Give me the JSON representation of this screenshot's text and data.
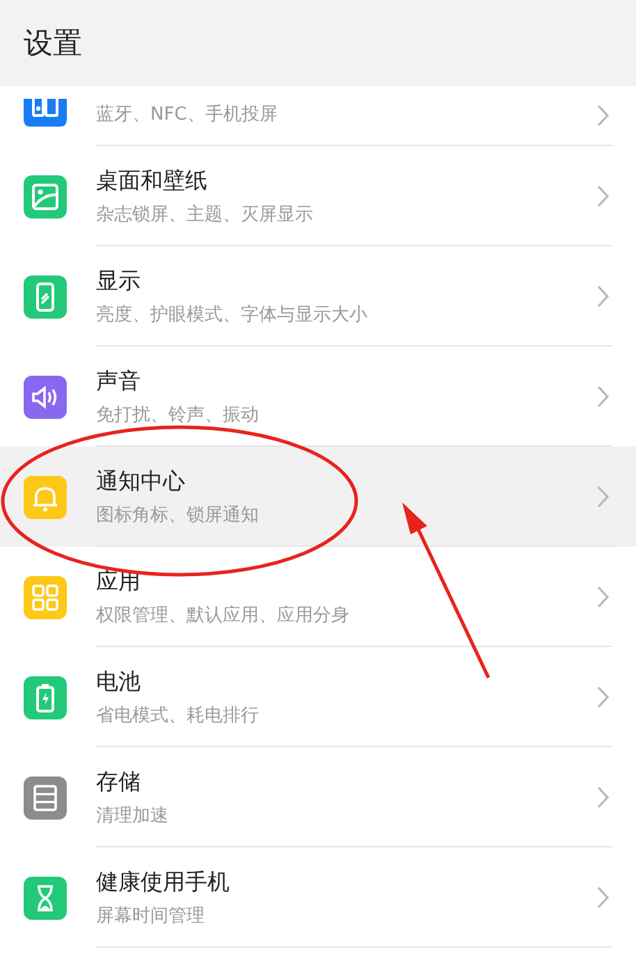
{
  "header": {
    "title": "设置"
  },
  "items": [
    {
      "kind": "devices",
      "color": "#1a7cf5",
      "subtitle": "蓝牙、NFC、手机投屏",
      "selected": false,
      "partial": true
    },
    {
      "kind": "wallpaper",
      "color": "#22c979",
      "title": "桌面和壁纸",
      "subtitle": "杂志锁屏、主题、灭屏显示",
      "selected": false
    },
    {
      "kind": "display",
      "color": "#22c979",
      "title": "显示",
      "subtitle": "亮度、护眼模式、字体与显示大小",
      "selected": false
    },
    {
      "kind": "sound",
      "color": "#8a67f0",
      "title": "声音",
      "subtitle": "免打扰、铃声、振动",
      "selected": false
    },
    {
      "kind": "bell",
      "color": "#fdc817",
      "title": "通知中心",
      "subtitle": "图标角标、锁屏通知",
      "selected": true
    },
    {
      "kind": "apps",
      "color": "#fdc817",
      "title": "应用",
      "subtitle": "权限管理、默认应用、应用分身",
      "selected": false
    },
    {
      "kind": "battery",
      "color": "#22c979",
      "title": "电池",
      "subtitle": "省电模式、耗电排行",
      "selected": false
    },
    {
      "kind": "storage",
      "color": "#8c8c8c",
      "title": "存储",
      "subtitle": "清理加速",
      "selected": false
    },
    {
      "kind": "hourglass",
      "color": "#22c979",
      "title": "健康使用手机",
      "subtitle": "屏幕时间管理",
      "selected": false
    }
  ],
  "annotations": [
    {
      "kind": "ellipse"
    },
    {
      "kind": "arrow"
    }
  ]
}
